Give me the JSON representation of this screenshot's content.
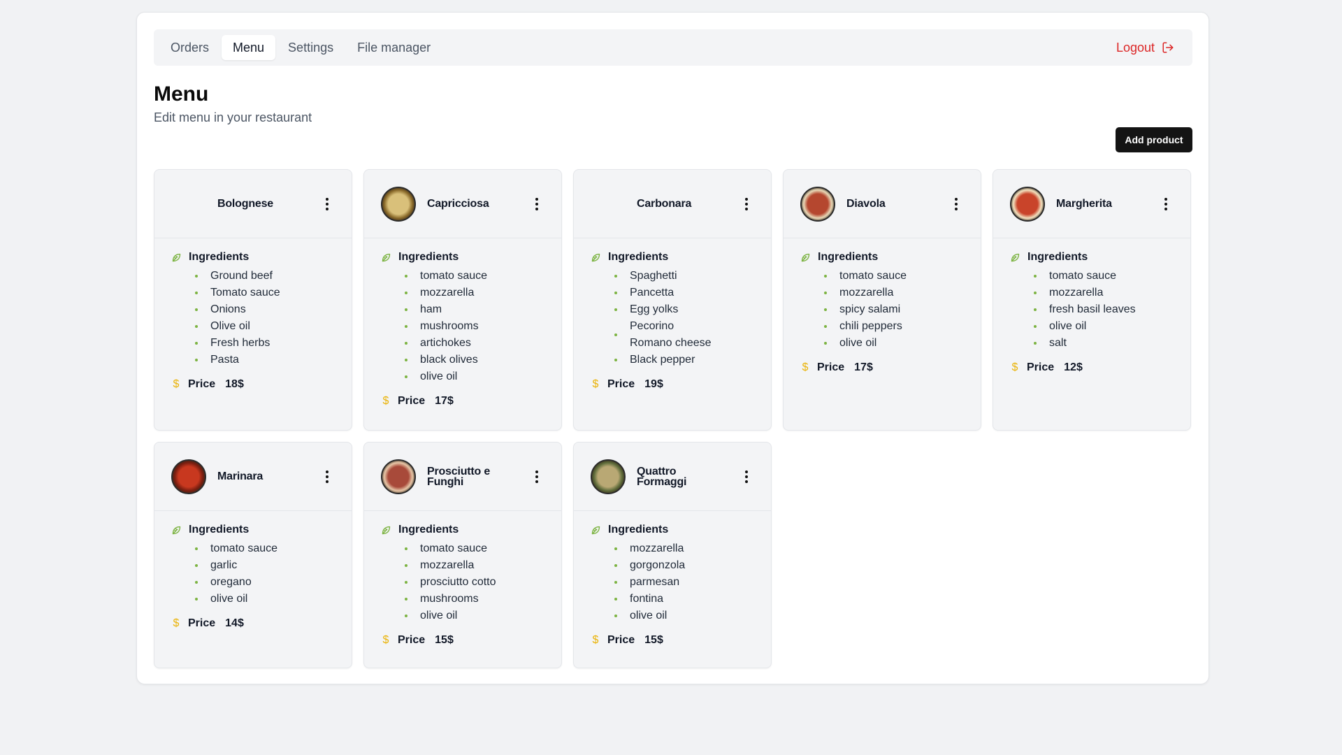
{
  "nav": {
    "tabs": [
      {
        "label": "Orders",
        "active": false
      },
      {
        "label": "Menu",
        "active": true
      },
      {
        "label": "Settings",
        "active": false
      },
      {
        "label": "File manager",
        "active": false
      }
    ],
    "logout_label": "Logout"
  },
  "page": {
    "title": "Menu",
    "subtitle": "Edit menu in your restaurant",
    "add_button": "Add product"
  },
  "labels": {
    "ingredients": "Ingredients",
    "price": "Price"
  },
  "colors": {
    "accent_green": "#7cb342",
    "price_icon": "#eab308",
    "logout": "#dc2626",
    "button_dark": "#141414"
  },
  "products": [
    {
      "name": "Bolognese",
      "image": "none",
      "ingredients": [
        "Ground beef",
        "Tomato sauce",
        "Onions",
        "Olive oil",
        "Fresh herbs",
        "Pasta"
      ],
      "price": "18$"
    },
    {
      "name": "Capricciosa",
      "image": "pizza-photo",
      "ingredients": [
        "tomato sauce",
        "mozzarella",
        "ham",
        "mushrooms",
        "artichokes",
        "black olives",
        "olive oil"
      ],
      "price": "17$"
    },
    {
      "name": "Carbonara",
      "image": "none",
      "ingredients": [
        "Spaghetti",
        "Pancetta",
        "Egg yolks",
        "Pecorino Romano cheese",
        "Black pepper"
      ],
      "price": "19$"
    },
    {
      "name": "Diavola",
      "image": "pizza-photo",
      "ingredients": [
        "tomato sauce",
        "mozzarella",
        "spicy salami",
        "chili peppers",
        "olive oil"
      ],
      "price": "17$"
    },
    {
      "name": "Margherita",
      "image": "pizza-photo",
      "ingredients": [
        "tomato sauce",
        "mozzarella",
        "fresh basil leaves",
        "olive oil",
        "salt"
      ],
      "price": "12$"
    },
    {
      "name": "Marinara",
      "image": "pizza-photo",
      "ingredients": [
        "tomato sauce",
        "garlic",
        "oregano",
        "olive oil"
      ],
      "price": "14$"
    },
    {
      "name": "Prosciutto e Funghi",
      "image": "pizza-photo",
      "ingredients": [
        "tomato sauce",
        "mozzarella",
        "prosciutto cotto",
        "mushrooms",
        "olive oil"
      ],
      "price": "15$"
    },
    {
      "name": "Quattro Formaggi",
      "image": "pizza-photo",
      "ingredients": [
        "mozzarella",
        "gorgonzola",
        "parmesan",
        "fontina",
        "olive oil"
      ],
      "price": "15$"
    }
  ]
}
